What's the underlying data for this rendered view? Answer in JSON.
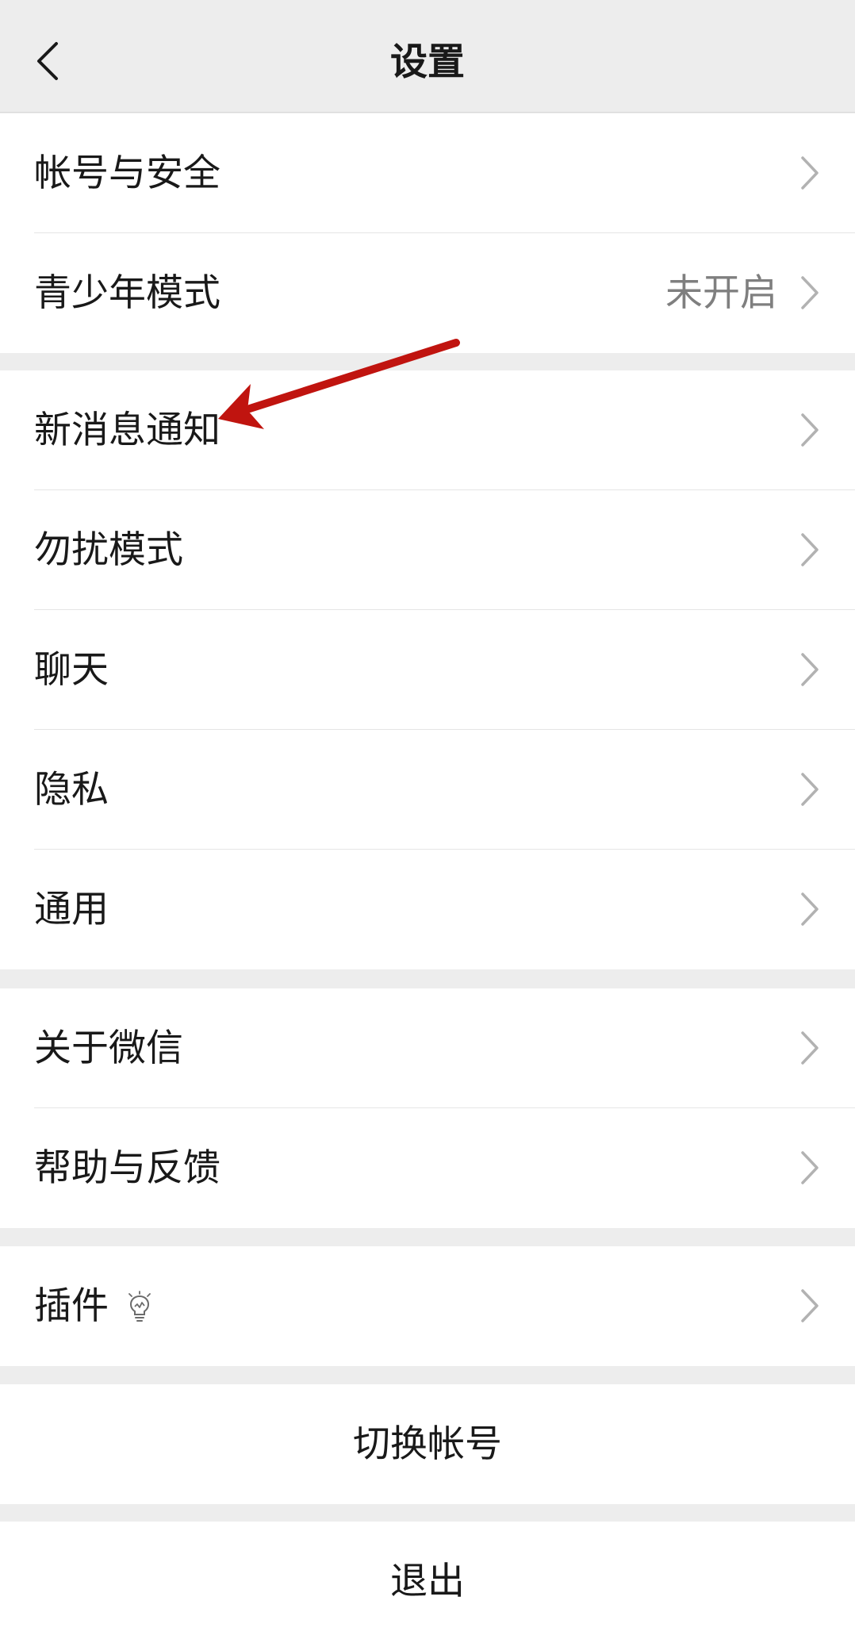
{
  "header": {
    "title": "设置"
  },
  "groups": {
    "account": {
      "items": [
        {
          "label": "帐号与安全"
        },
        {
          "label": "青少年模式",
          "value": "未开启"
        }
      ]
    },
    "notifications": {
      "items": [
        {
          "label": "新消息通知"
        },
        {
          "label": "勿扰模式"
        },
        {
          "label": "聊天"
        },
        {
          "label": "隐私"
        },
        {
          "label": "通用"
        }
      ]
    },
    "about": {
      "items": [
        {
          "label": "关于微信"
        },
        {
          "label": "帮助与反馈"
        }
      ]
    },
    "plugins": {
      "items": [
        {
          "label": "插件"
        }
      ]
    }
  },
  "actions": {
    "switch_account": "切换帐号",
    "logout": "退出"
  },
  "colors": {
    "annotation_arrow": "#c0140f",
    "background": "#ededed",
    "chevron": "#b2b2b2"
  }
}
